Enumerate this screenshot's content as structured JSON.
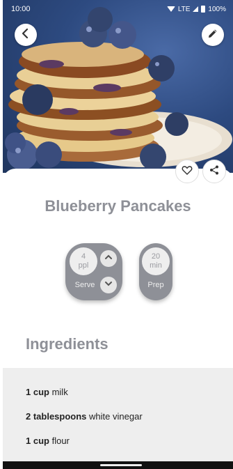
{
  "status_bar": {
    "time": "10:00",
    "network": "LTE",
    "battery": "100%"
  },
  "header": {
    "back_icon": "arrow-left-icon",
    "edit_icon": "pencil-icon"
  },
  "actions": {
    "favorite_icon": "heart-icon",
    "share_icon": "share-icon"
  },
  "recipe": {
    "title": "Blueberry Pancakes"
  },
  "serve": {
    "value": "4",
    "unit": "ppl",
    "label": "Serve"
  },
  "prep": {
    "value": "20",
    "unit": "min",
    "label": "Prep"
  },
  "ingredients": {
    "heading": "Ingredients",
    "items": [
      {
        "qty": "1 cup",
        "name": "milk"
      },
      {
        "qty": "2 tablespoons",
        "name": "white vinegar"
      },
      {
        "qty": "1 cup",
        "name": "flour"
      }
    ]
  },
  "colors": {
    "accent": "#8e9097",
    "pill_text": "#eeeeee",
    "list_bg": "#eeeeee"
  }
}
